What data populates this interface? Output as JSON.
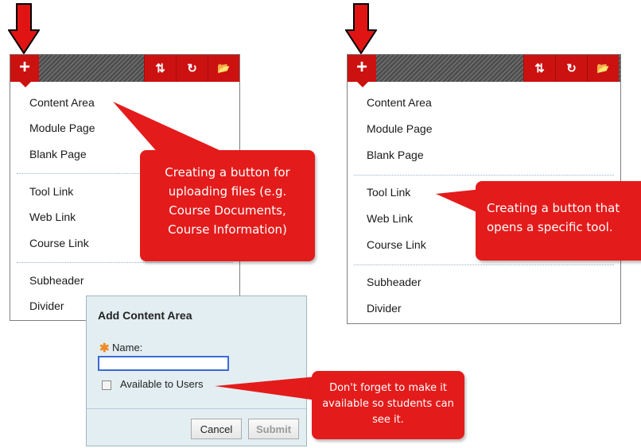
{
  "left_panel": {
    "toolbar": {
      "add_icon": "+",
      "sort_icon": "⇅",
      "refresh_icon": "↻",
      "folder_icon": "📂"
    },
    "menu": [
      "Content Area",
      "Module Page",
      "Blank Page",
      "Tool Link",
      "Web Link",
      "Course Link",
      "Subheader",
      "Divider"
    ]
  },
  "right_panel": {
    "menu": [
      "Content Area",
      "Module Page",
      "Blank Page",
      "Tool Link",
      "Web Link",
      "Course Link",
      "Subheader",
      "Divider"
    ]
  },
  "callouts": {
    "content_area": "Creating a button  for uploading files (e.g. Course Documents, Course Information)",
    "tool_link": "Creating a button that opens a specific tool.",
    "available": "Don't forget to make it available so students can see it."
  },
  "dialog": {
    "title": "Add Content Area",
    "required_mark": "✱",
    "name_label": "Name:",
    "name_value": "",
    "available_label": "Available to Users",
    "available_checked": false,
    "cancel_label": "Cancel",
    "submit_label": "Submit"
  },
  "colors": {
    "accent_red": "#cc1111",
    "callout_red": "#e41b1b",
    "required_orange": "#f08a24"
  }
}
